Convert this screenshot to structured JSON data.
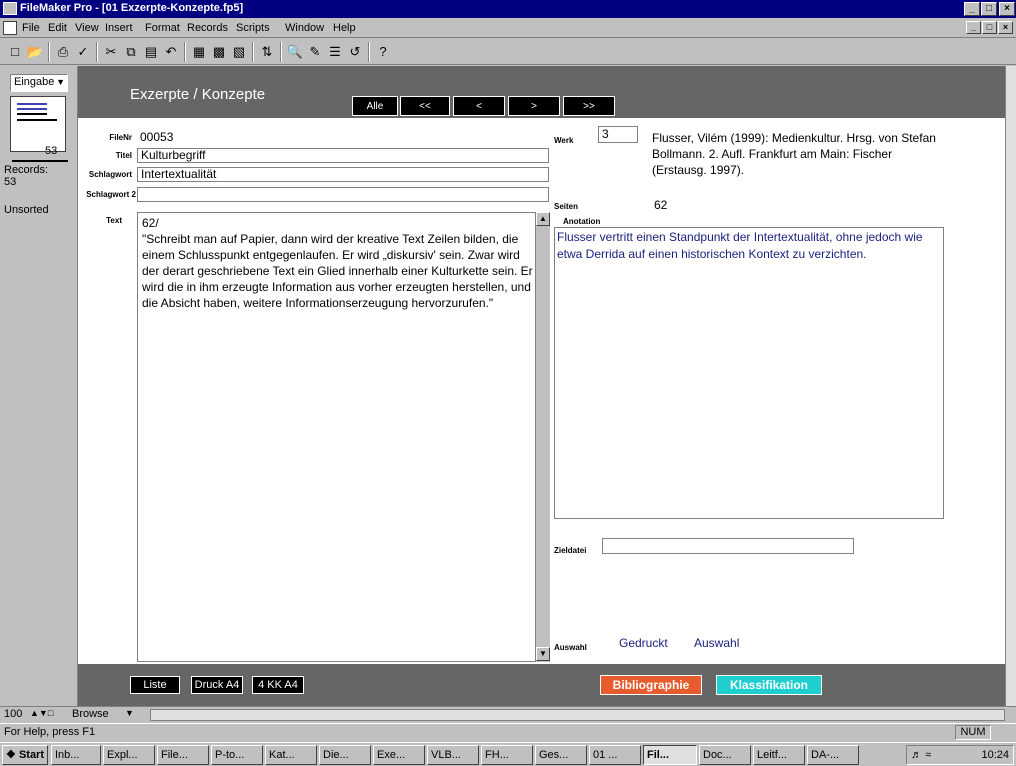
{
  "window": {
    "title": "FileMaker Pro - [01 Exzerpte-Konzepte.fp5]",
    "min": "_",
    "max": "□",
    "close": "×",
    "mdi_min": "_",
    "mdi_max": "□",
    "mdi_close": "×"
  },
  "menu": [
    "File",
    "Edit",
    "View",
    "Insert",
    "Format",
    "Records",
    "Scripts",
    "Window",
    "Help"
  ],
  "toolbar_icons": [
    "new-icon",
    "open-icon",
    "print-icon",
    "spellcheck-icon",
    "cut-icon",
    "copy-icon",
    "paste-icon",
    "undo-icon",
    "new-record-icon",
    "duplicate-record-icon",
    "delete-record-icon",
    "sort-icon",
    "find-icon",
    "omit-icon",
    "show-all-icon",
    "replace-icon",
    "help-icon"
  ],
  "status_area": {
    "layout": "Eingabe",
    "current_record": "53",
    "records_label": "Records:",
    "records_count": "53",
    "sort_status": "Unsorted"
  },
  "layout": {
    "title": "Exzerpte / Konzepte",
    "nav_buttons": [
      "Alle",
      "<<",
      "<",
      ">",
      ">>"
    ],
    "labels": {
      "filenr": "FileNr",
      "titel": "Titel",
      "schlagwort": "Schlagwort",
      "schlagwort2": "Schlagwort 2",
      "text": "Text",
      "werk": "Werk",
      "seiten": "Seiten",
      "anotation": "Anotation",
      "zieldatei": "Zieldatei",
      "auswahl": "Auswahl"
    },
    "values": {
      "filenr": "00053",
      "titel": "Kulturbegriff",
      "schlagwort": "Intertextualität",
      "schlagwort2": "",
      "text_line1": "62/",
      "text_body": "\"Schreibt man auf Papier, dann wird der kreative Text Zeilen bilden, die einem Schlusspunkt entgegenlaufen. Er wird „diskursiv' sein. Zwar wird der derart geschriebene Text ein Glied innerhalb einer Kulturkette sein. Er wird die in ihm erzeugte Information aus vorher erzeugten herstellen, und die Absicht haben, weitere Informationserzeugung hervorzurufen.\"",
      "werk": "3",
      "werk_reference": "Flusser, Vilém (1999): Medienkultur. Hrsg. von Stefan Bollmann. 2. Aufl. Frankfurt am Main: Fischer (Erstausg. 1997).",
      "seiten": "62",
      "anotation": "Flusser vertritt einen Standpunkt der Intertextualität, ohne jedoch wie etwa Derrida auf einen historischen Kontext zu verzichten.",
      "zieldatei": "",
      "auswahl_option1": "Gedruckt",
      "auswahl_option2": "Auswahl"
    },
    "footer_buttons": {
      "liste": "Liste",
      "druck": "Druck A4",
      "kk": "4 KK A4",
      "bibliographie": "Bibliographie",
      "klassifikation": "Klassifikation"
    }
  },
  "bottom": {
    "zoom": "100",
    "mode": "Browse"
  },
  "statusbar": {
    "help": "For Help, press F1",
    "num": "NUM"
  },
  "taskbar": {
    "start": "Start",
    "tasks": [
      "Inb...",
      "Expl...",
      "File...",
      "P-to...",
      "Kat...",
      "Die...",
      "Exe...",
      "VLB...",
      "FH...",
      "Ges...",
      "01 ...",
      "Fil...",
      "Doc...",
      "Leitf...",
      "DA-..."
    ],
    "active_task": "Fil...",
    "time": "10:24"
  },
  "colors": {
    "band": "#666666",
    "bibliographie": "#e65c2e",
    "klassifikation": "#1fcfcf",
    "titlebar": "#000080"
  }
}
